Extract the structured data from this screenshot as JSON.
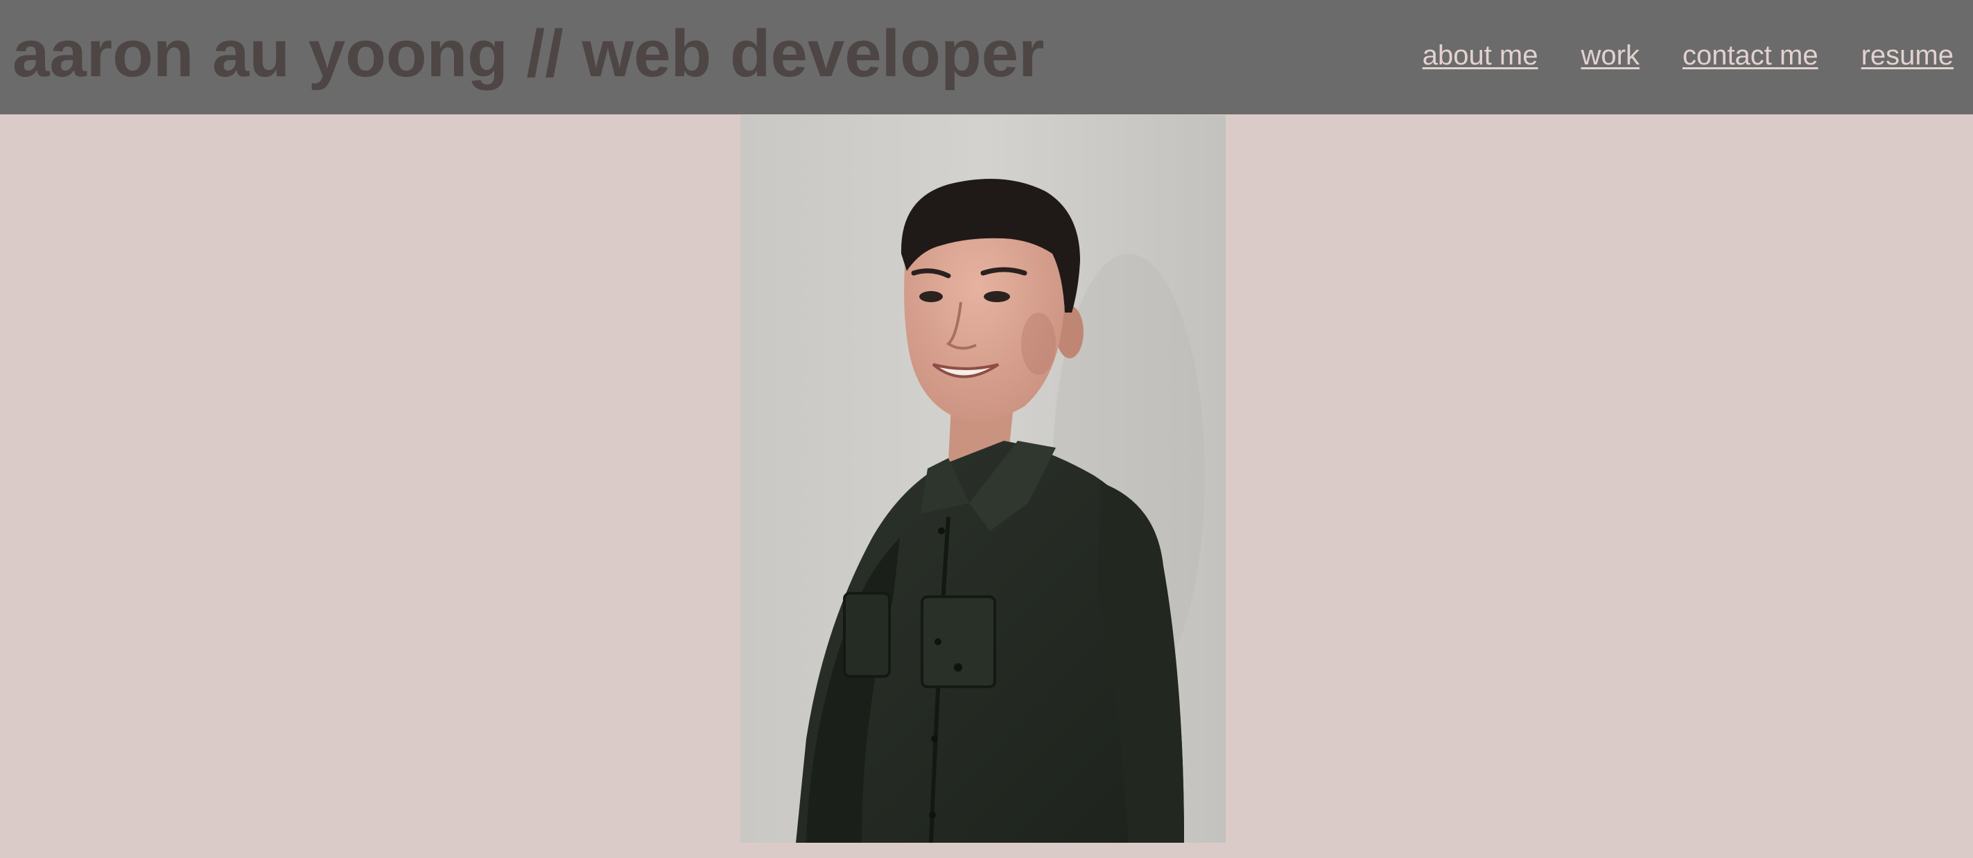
{
  "header": {
    "title": "aaron au yoong // web developer",
    "nav": [
      {
        "label": "about me"
      },
      {
        "label": "work"
      },
      {
        "label": "contact me"
      },
      {
        "label": "resume"
      }
    ]
  },
  "main": {
    "photo": {
      "subject": "portrait of a smiling young man in a dark green button-up shirt against a light grey wall"
    }
  },
  "colors": {
    "background": "#dbcbc8",
    "header": "#6b6b6b",
    "title_text": "#4e4545",
    "nav_link": "#e3d2d0"
  }
}
